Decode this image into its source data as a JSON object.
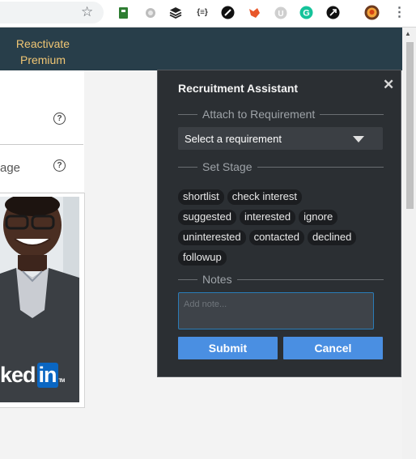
{
  "browser": {
    "star_icon": "star-icon",
    "extensions": [
      {
        "name": "ext-green-tag-icon",
        "color": "#2e7d32"
      },
      {
        "name": "ext-gray-circle-icon",
        "color": "#9e9e9e"
      },
      {
        "name": "ext-layers-icon",
        "color": "#222222"
      },
      {
        "name": "ext-json-icon",
        "glyph": "{≡}",
        "color": "#333333"
      },
      {
        "name": "ext-compass-icon",
        "color": "#111111"
      },
      {
        "name": "ext-fox-icon",
        "color": "#e8572a"
      },
      {
        "name": "ext-shield-u-icon",
        "glyph": "U",
        "color": "#bdbdbd"
      },
      {
        "name": "ext-grammarly-icon",
        "glyph": "G",
        "color": "#15c39a"
      },
      {
        "name": "ext-arrow-circle-icon",
        "color": "#111111"
      },
      {
        "name": "profile-avatar-icon",
        "color": "#d84315"
      }
    ],
    "menu_icon": "⋮"
  },
  "page": {
    "reactivate_label": "Reactivate Premium",
    "age_text": "age",
    "help_glyph": "?",
    "ad_logo_text": "ked",
    "ad_logo_in": "in",
    "ad_logo_tm": "TM"
  },
  "panel": {
    "title": "Recruitment Assistant",
    "close_label": "✕",
    "attach_heading": "Attach to Requirement",
    "select_placeholder": "Select a requirement",
    "stage_heading": "Set Stage",
    "stages": [
      "shortlist",
      "check interest",
      "suggested",
      "interested",
      "ignore",
      "uninterested",
      "contacted",
      "declined",
      "followup"
    ],
    "notes_heading": "Notes",
    "notes_placeholder": "Add note...",
    "submit_label": "Submit",
    "cancel_label": "Cancel"
  },
  "colors": {
    "panel_bg": "#2b2f33",
    "chip_bg": "#1b1d20",
    "button_blue": "#4a8fe2",
    "nav_bg": "#283e4a",
    "premium_gold": "#f0c674"
  }
}
